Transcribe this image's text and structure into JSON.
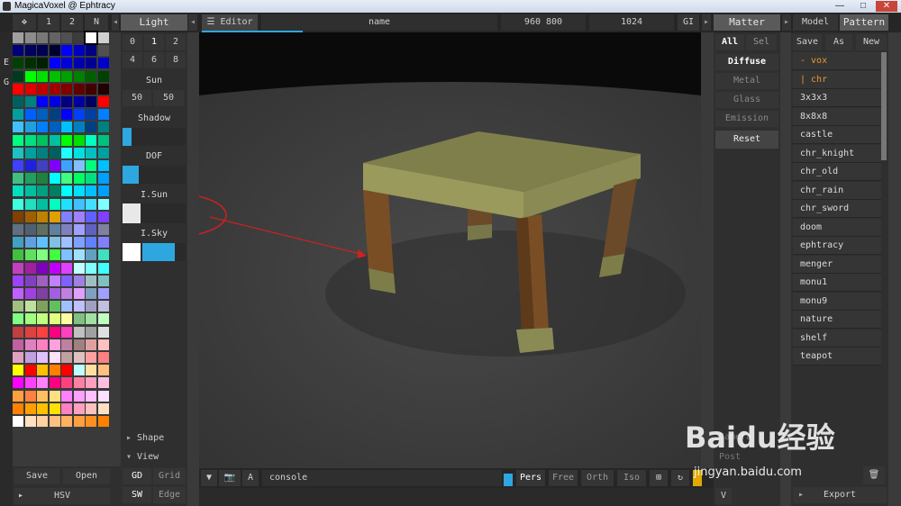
{
  "window": {
    "title": "MagicaVoxel @ Ephtracy",
    "min": "—",
    "max": "□",
    "close": "✕"
  },
  "top_left_tabs": [
    "1",
    "2",
    "N"
  ],
  "side_letters": [
    "E",
    "G"
  ],
  "palette": {
    "colors": [
      "#a0a0a0",
      "#8c8c8c",
      "#787878",
      "#646464",
      "#505050",
      "#3c3c3c",
      "#ffffff",
      "#d0d0d0",
      "#00007c",
      "#00005e",
      "#000050",
      "#000030",
      "#0000ff",
      "#0000c0",
      "#000080",
      "#505050",
      "#004000",
      "#003000",
      "#002000",
      "#0000ff",
      "#0000d8",
      "#0000b0",
      "#000090",
      "#0000c8",
      "#003a1e",
      "#00ff00",
      "#00e000",
      "#00c000",
      "#00a000",
      "#008000",
      "#006000",
      "#004000",
      "#ff0000",
      "#e00000",
      "#c00000",
      "#a00000",
      "#800000",
      "#600000",
      "#400000",
      "#200000",
      "#006060",
      "#008080",
      "#0000ff",
      "#0000e0",
      "#000080",
      "#0000a0",
      "#000060",
      "#ff0000",
      "#00a0a0",
      "#0060ff",
      "#0060c0",
      "#004080",
      "#0000ff",
      "#0040ff",
      "#0040a0",
      "#0080ff",
      "#40c0ff",
      "#20a0e0",
      "#0080ff",
      "#0060c0",
      "#00c0ff",
      "#0080c0",
      "#004080",
      "#008080",
      "#00ff80",
      "#00e080",
      "#00c060",
      "#00c0a0",
      "#00ff00",
      "#00e000",
      "#00ffc0",
      "#00c080",
      "#20c0c0",
      "#00a0a0",
      "#008080",
      "#006060",
      "#20ffff",
      "#00e0e0",
      "#00c0c0",
      "#00a0a0",
      "#4040ff",
      "#2020e0",
      "#4040c0",
      "#8000ff",
      "#40a0ff",
      "#80c0ff",
      "#00ff80",
      "#00c0ff",
      "#40c080",
      "#20a060",
      "#208040",
      "#00ffff",
      "#40ff80",
      "#00ff60",
      "#00e080",
      "#00a0ff",
      "#00e0c0",
      "#00c0a0",
      "#00a080",
      "#008060",
      "#00ffff",
      "#00e0ff",
      "#00c0ff",
      "#00a0ff",
      "#40ffe0",
      "#20e0c0",
      "#00c0a0",
      "#00ffc0",
      "#20e0ff",
      "#40c0ff",
      "#40e0ff",
      "#80ffff",
      "#804000",
      "#a06000",
      "#c08000",
      "#e0a000",
      "#8080ff",
      "#a080ff",
      "#6060ff",
      "#8040ff",
      "#607080",
      "#506070",
      "#607060",
      "#6080a0",
      "#8080c0",
      "#a0a0ff",
      "#6060c0",
      "#8080a0",
      "#40a0c0",
      "#60a0e0",
      "#60c0ff",
      "#80c0e0",
      "#a0c0ff",
      "#80a0ff",
      "#6080ff",
      "#8080ff",
      "#40c040",
      "#60e060",
      "#80ff80",
      "#40ff40",
      "#80c0ff",
      "#a0e0ff",
      "#60a0c0",
      "#40e0c0",
      "#c040c0",
      "#a020a0",
      "#8000c0",
      "#c000ff",
      "#e040ff",
      "#c0ffff",
      "#80ffff",
      "#40ffff",
      "#a040ff",
      "#8040c0",
      "#a060c0",
      "#c080ff",
      "#8060ff",
      "#a080e0",
      "#a0c0c0",
      "#80c0c0",
      "#c060ff",
      "#a040e0",
      "#8040a0",
      "#a060e0",
      "#c080e0",
      "#e0a0ff",
      "#80a0c0",
      "#a0a0ff",
      "#a0c080",
      "#c0e0a0",
      "#80a060",
      "#60c060",
      "#a0c0ff",
      "#c0c0ff",
      "#a0a0c0",
      "#c0c0e0",
      "#80ff80",
      "#a0ff80",
      "#c0ff80",
      "#e0ff80",
      "#ffffa0",
      "#80c080",
      "#a0e0a0",
      "#c0ffc0",
      "#c04040",
      "#e04040",
      "#ff4040",
      "#ff0080",
      "#ff40c0",
      "#c0c0c0",
      "#a0a0a0",
      "#e0e0e0",
      "#c060a0",
      "#e080c0",
      "#ff80c0",
      "#ffa0e0",
      "#c080a0",
      "#a08080",
      "#e0a0a0",
      "#ffc0c0",
      "#e0a0c0",
      "#c0a0e0",
      "#e0c0ff",
      "#ffe0ff",
      "#c0a0a0",
      "#e0c0c0",
      "#ffa0a0",
      "#ff8080",
      "#ffff00",
      "#ff0000",
      "#ffc000",
      "#ff8000",
      "#ff0000",
      "#c0ffff",
      "#ffe0a0",
      "#ffc080",
      "#ff00ff",
      "#ff40ff",
      "#ff80ff",
      "#ff0080",
      "#ff4080",
      "#ff80a0",
      "#ffa0c0",
      "#ffc0e0",
      "#ffa040",
      "#ff8040",
      "#ffc060",
      "#ffe080",
      "#ff80ff",
      "#ffa0ff",
      "#ffc0ff",
      "#ffe0ff",
      "#ff8000",
      "#ffa000",
      "#ffc000",
      "#ffe000",
      "#ff80c0",
      "#ffa0c0",
      "#ffc0c0",
      "#ffe0c0",
      "#ffffff",
      "#ffe0c0",
      "#ffd0a0",
      "#ffc080",
      "#ffb060",
      "#ffa040",
      "#ff9020",
      "#ff8000"
    ],
    "save": "Save",
    "open": "Open",
    "hsv": "HSV"
  },
  "light": {
    "header": "Light",
    "row1": [
      "0",
      "1",
      "2"
    ],
    "row2": [
      "4",
      "6",
      "8"
    ],
    "sun_label": "Sun",
    "sun_values": [
      "50",
      "50"
    ],
    "shadow_label": "Shadow",
    "dof_label": "DOF",
    "isun_label": "I.Sun",
    "isky_label": "I.Sky",
    "isun_color": "#e8e8e8",
    "isky_color": "#ffffff",
    "accent": "#2ea7e0",
    "shape": "Shape",
    "view": "View",
    "gd": "GD",
    "grid": "Grid",
    "sw": "SW",
    "edge": "Edge"
  },
  "editor": {
    "tab": "Editor",
    "name": "name",
    "size": "960 800",
    "samples": "1024",
    "gi": "GI",
    "console": "console",
    "a_label": "A",
    "views": [
      "Pers",
      "Free",
      "Orth",
      "Iso"
    ]
  },
  "matter": {
    "header": "Matter",
    "all": "All",
    "sel": "Sel",
    "items": [
      "Diffuse",
      "Metal",
      "Glass",
      "Emission"
    ],
    "reset": "Reset",
    "v_label": "V"
  },
  "models": {
    "tab_model": "Model",
    "tab_pattern": "Pattern",
    "save": "Save",
    "as": "As",
    "new": "New",
    "items": [
      "- vox",
      "| chr",
      "3x3x3",
      "8x8x8",
      "castle",
      "chr_knight",
      "chr_old",
      "chr_rain",
      "chr_sword",
      "doom",
      "ephtracy",
      "menger",
      "monu1",
      "monu9",
      "nature",
      "shelf",
      "teapot"
    ],
    "export": "Export"
  },
  "watermark": {
    "brand": "Baidu经验",
    "url": "jingyan.baidu.com",
    "faint1": "Camera",
    "faint2": "Post"
  }
}
